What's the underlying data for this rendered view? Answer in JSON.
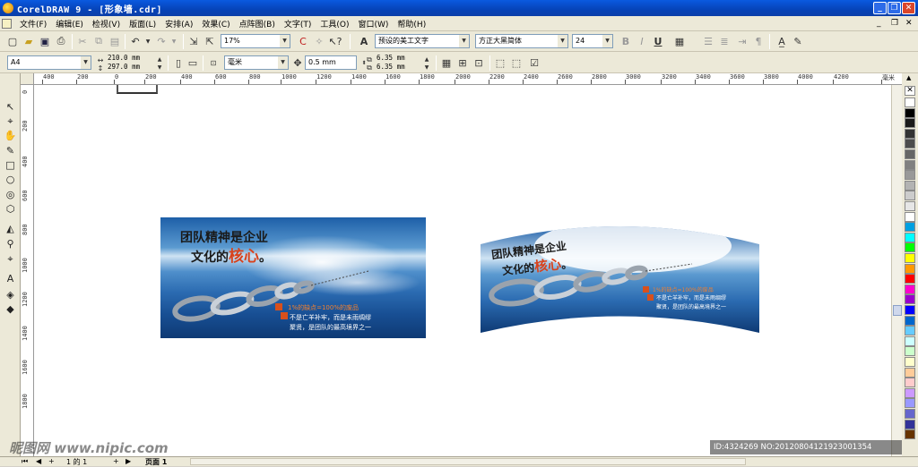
{
  "window": {
    "title": "CorelDRAW 9 - [形象墙.cdr]",
    "controls": [
      "_",
      "❐",
      "✕"
    ]
  },
  "menu": {
    "items": [
      "文件(F)",
      "编辑(E)",
      "检视(V)",
      "版面(L)",
      "安排(A)",
      "效果(C)",
      "点阵图(B)",
      "文字(T)",
      "工具(O)",
      "窗口(W)",
      "帮助(H)"
    ],
    "right_controls": [
      "_",
      "❐",
      "✕"
    ]
  },
  "standard_toolbar": {
    "zoom": "17%",
    "font_style_preset": "预设的美工文字",
    "font_name": "方正大黑简体",
    "font_size": "24",
    "bold": "B",
    "italic": "I",
    "underline": "U"
  },
  "property_bar": {
    "paper": "A4",
    "width": "210.0 mm",
    "height": "297.0 mm",
    "units": "毫米",
    "nudge": "0.5 mm",
    "dup_x": "6.35 mm",
    "dup_y": "6.35 mm"
  },
  "rulers": {
    "horizontal": [
      "400",
      "200",
      "0",
      "200",
      "400",
      "600",
      "800",
      "1000",
      "1200",
      "1400",
      "1600",
      "1800",
      "2000",
      "2200",
      "2400",
      "2600",
      "2800",
      "3000",
      "3200",
      "3400",
      "3600",
      "3800",
      "4000",
      "4200"
    ],
    "horizontal_unit": "毫米",
    "vertical": [
      "0",
      "200",
      "400",
      "600",
      "800",
      "1000",
      "1200",
      "1400",
      "1600",
      "1800"
    ]
  },
  "artwork_flat": {
    "headline_line1": "团队精神是企业",
    "headline_line2_prefix": "文化的",
    "headline_highlight": "核心",
    "headline_end": "。",
    "caption_orange": "1%的缺点=100%的废品",
    "caption_white_1": "不是亡羊补牢，而是未雨绸缪",
    "caption_white_2": "聚贤，是团队的最高境界之一"
  },
  "artwork_curved": {
    "headline_line1": "团队精神是企业",
    "headline_line2_prefix": "文化的",
    "headline_highlight": "核心",
    "headline_end": "。",
    "caption_orange": "1%的缺点=100%的废品",
    "caption_white_1": "不是亡羊补牢，而是未雨绸缪",
    "caption_white_2": "聚贤，是团队的最高境界之一"
  },
  "status": {
    "page_counter": "1 的 1",
    "page_tab": "页面 1"
  },
  "overlay": {
    "watermark": "昵图网 www.nipic.com",
    "image_id": "ID:4324269 NO:20120804121923001354"
  },
  "colors": {
    "titlebar": "#0a5ae0",
    "chrome": "#ece9d8",
    "accent_red": "#d8421c",
    "palette": [
      "#ffffff",
      "#000000",
      "#1a1a1a",
      "#333333",
      "#4d4d4d",
      "#666666",
      "#808080",
      "#999999",
      "#b3b3b3",
      "#cccccc",
      "#e6e6e6",
      "#ffffff",
      "#00a0e0",
      "#00ffff",
      "#00ff00",
      "#ffff00",
      "#ff9900",
      "#ff0000",
      "#ff00cc",
      "#9900cc",
      "#0000ff",
      "#0066cc",
      "#66ccff",
      "#ccffff",
      "#ccffcc",
      "#ffffcc",
      "#ffcc99",
      "#ffcccc",
      "#cc99ff",
      "#9999ff",
      "#6666cc",
      "#333399",
      "#663300"
    ]
  },
  "icons": {
    "standard": [
      "new-icon",
      "open-icon",
      "save-icon",
      "print-icon",
      "cut-icon",
      "copy-icon",
      "paste-icon",
      "undo-icon",
      "redo-icon",
      "import-icon",
      "export-icon",
      "zoom-combo",
      "launcher-icon",
      "cursor-icon"
    ],
    "tools": [
      "pick-tool-icon",
      "shape-tool-icon",
      "pan-tool-icon",
      "freehand-tool-icon",
      "rectangle-tool-icon",
      "ellipse-tool-icon",
      "spiral-tool-icon",
      "polygon-tool-icon",
      "text-tool-icon",
      "interactive-fill-icon",
      "eyedropper-icon",
      "outline-tool-icon",
      "fill-tool-icon",
      "interactive-fill2-icon"
    ]
  }
}
